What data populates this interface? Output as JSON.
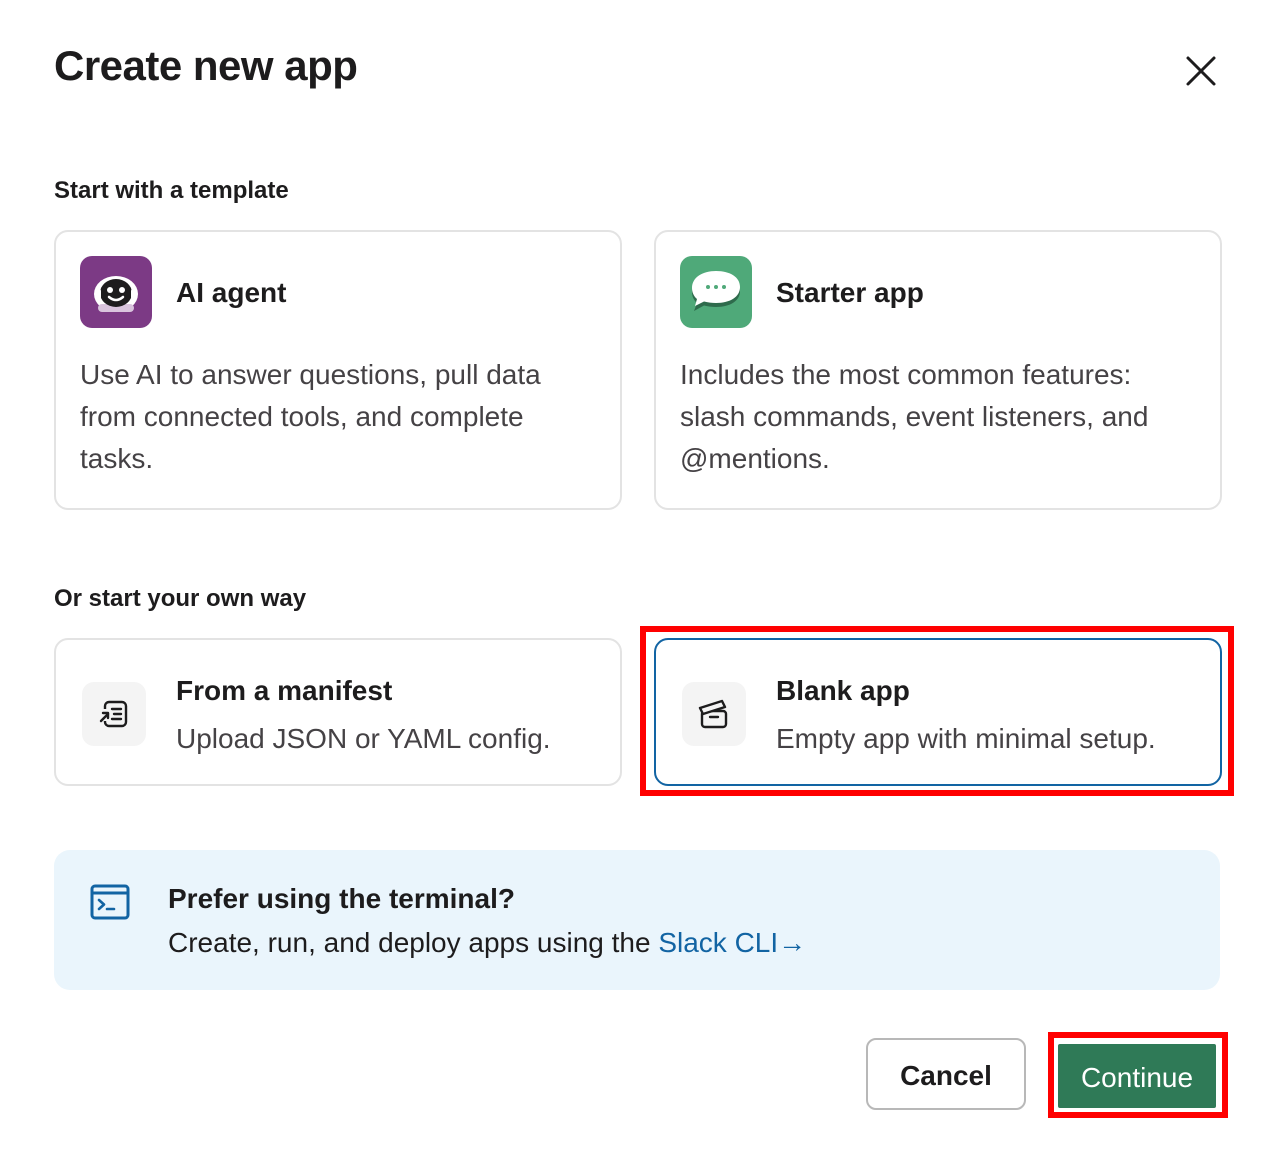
{
  "dialog": {
    "title": "Create new app",
    "close_icon": "close-icon"
  },
  "templates": {
    "label": "Start with a template",
    "items": [
      {
        "title": "AI agent",
        "description": "Use AI to answer questions, pull data from connected tools, and complete tasks.",
        "icon": "robot-icon",
        "icon_bg": "#7c3a85"
      },
      {
        "title": "Starter app",
        "description": "Includes the most common features: slash commands, event listeners, and @mentions.",
        "icon": "chat-bubble-icon",
        "icon_bg": "#4fa979"
      }
    ]
  },
  "own_way": {
    "label": "Or start your own way",
    "items": [
      {
        "title": "From a manifest",
        "description": "Upload JSON or YAML config.",
        "icon": "manifest-icon",
        "selected": false
      },
      {
        "title": "Blank app",
        "description": "Empty app with minimal setup.",
        "icon": "blank-box-icon",
        "selected": true
      }
    ]
  },
  "cli": {
    "title": "Prefer using the terminal?",
    "description": "Create, run, and deploy apps using the ",
    "link_text": "Slack CLI",
    "link_arrow": "→",
    "icon": "terminal-icon"
  },
  "footer": {
    "cancel_label": "Cancel",
    "continue_label": "Continue"
  },
  "colors": {
    "accent_blue": "#1264a3",
    "continue_green": "#2f7a57",
    "highlight_red": "#ff0000",
    "banner_bg": "#eaf5fc"
  }
}
